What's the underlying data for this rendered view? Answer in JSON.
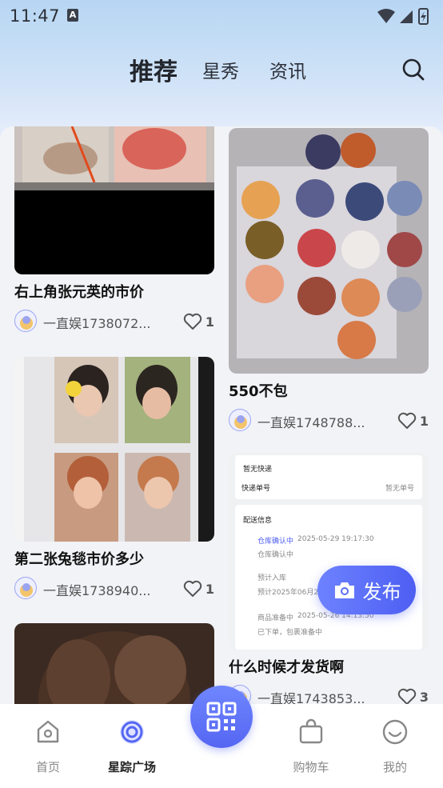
{
  "status_bar": {
    "time": "11:47",
    "app_badge": "A"
  },
  "top_nav": {
    "tabs": [
      {
        "label": "推荐",
        "active": true
      },
      {
        "label": "星秀",
        "active": false
      },
      {
        "label": "资讯",
        "active": false
      }
    ]
  },
  "feed": {
    "left": [
      {
        "title": "右上角张元英的市价",
        "username": "一直娱1738072...",
        "likes": "1"
      },
      {
        "title": "第二张兔毯市价多少",
        "username": "一直娱1738940...",
        "likes": "1"
      },
      {
        "title": "",
        "username": "",
        "likes": ""
      }
    ],
    "right": [
      {
        "title": "550不包",
        "username": "一直娱1748788...",
        "likes": "1"
      },
      {
        "title": "什么时候才发货啊",
        "username": "一直娱1743853...",
        "likes": "3"
      }
    ]
  },
  "shipping_screenshot": {
    "no_express": "暂无快递",
    "express_no_label": "快递单号",
    "express_no_value": "暂无单号",
    "delivery_info": "配送信息",
    "steps": [
      {
        "title": "仓库确认中",
        "time": "2025-05-29 19:17:30",
        "desc": "仓库确认中"
      },
      {
        "title": "预计入库",
        "time": "",
        "desc": "预计2025年06月2"
      },
      {
        "title": "商品准备中",
        "time": "2025-05-26 14:13:50",
        "desc": "已下单，包裹准备中"
      }
    ]
  },
  "publish_button": {
    "label": "发布"
  },
  "bottom_nav": {
    "items": [
      {
        "label": "首页",
        "icon": "home-icon",
        "active": false
      },
      {
        "label": "星踪广场",
        "icon": "target-icon",
        "active": true
      },
      {
        "label": "",
        "icon": "qr-scan-icon",
        "active": false
      },
      {
        "label": "购物车",
        "icon": "bag-icon",
        "active": false
      },
      {
        "label": "我的",
        "icon": "smile-icon",
        "active": false
      }
    ]
  },
  "colors": {
    "accent": "#5566f2",
    "header_gradient_top": "#b7d6f3",
    "background": "#f2f3f7"
  }
}
